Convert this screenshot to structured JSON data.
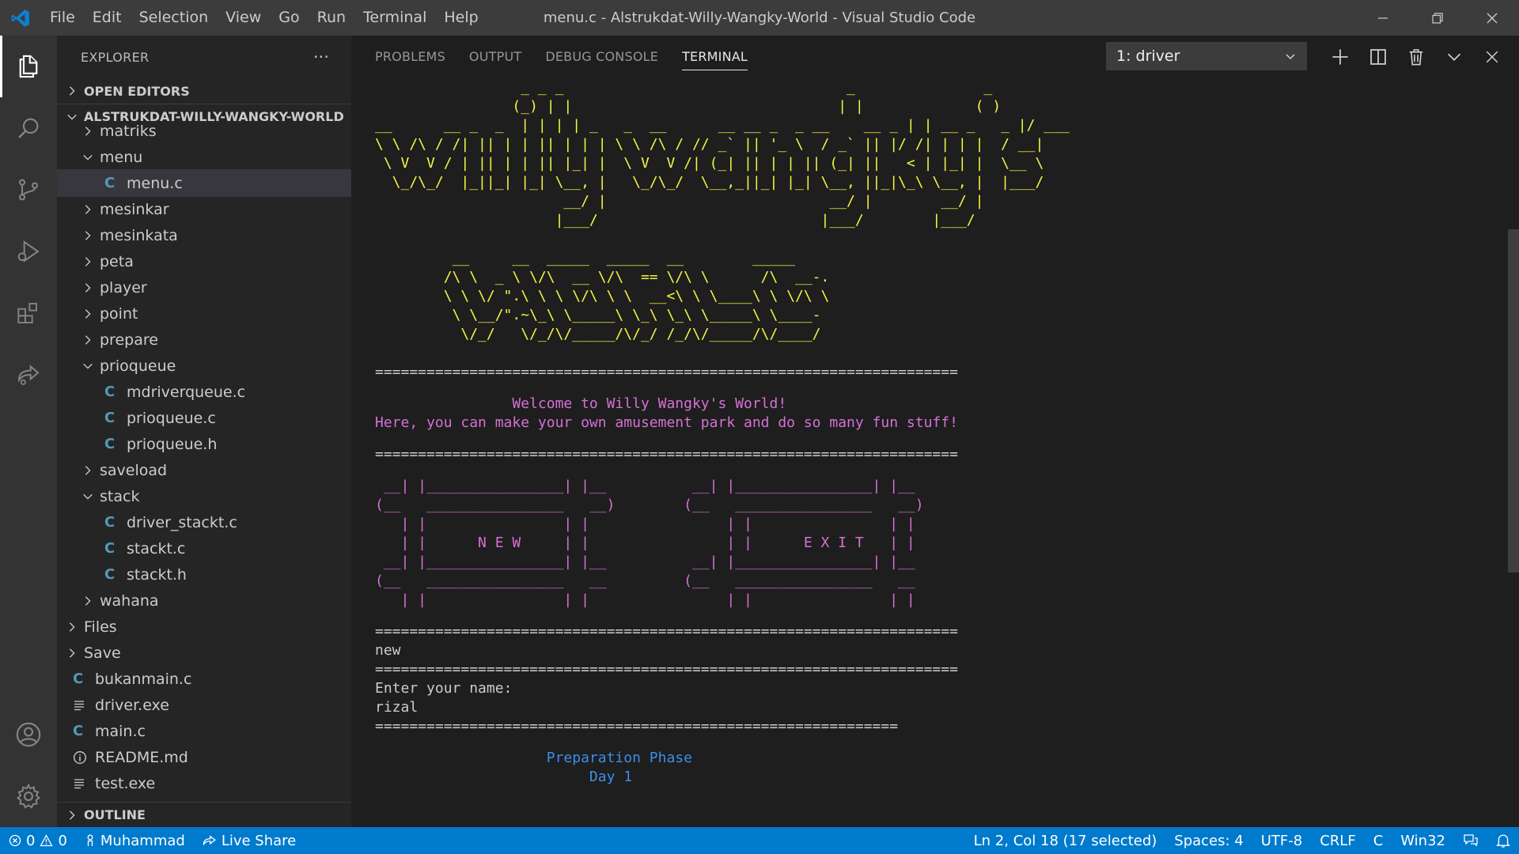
{
  "titlebar": {
    "menu": [
      "File",
      "Edit",
      "Selection",
      "View",
      "Go",
      "Run",
      "Terminal",
      "Help"
    ],
    "title": "menu.c - Alstrukdat-Willy-Wangky-World - Visual Studio Code"
  },
  "sidebar": {
    "header": "EXPLORER",
    "more": "···",
    "open_editors": "OPEN EDITORS",
    "project": "ALSTRUKDAT-WILLY-WANGKY-WORLD",
    "tree": [
      {
        "label": "matriks",
        "type": "folder",
        "state": "collapsed"
      },
      {
        "label": "menu",
        "type": "folder",
        "state": "expanded"
      },
      {
        "label": "menu.c",
        "type": "c",
        "selected": true
      },
      {
        "label": "mesinkar",
        "type": "folder",
        "state": "collapsed"
      },
      {
        "label": "mesinkata",
        "type": "folder",
        "state": "collapsed"
      },
      {
        "label": "peta",
        "type": "folder",
        "state": "collapsed"
      },
      {
        "label": "player",
        "type": "folder",
        "state": "collapsed"
      },
      {
        "label": "point",
        "type": "folder",
        "state": "collapsed"
      },
      {
        "label": "prepare",
        "type": "folder",
        "state": "collapsed"
      },
      {
        "label": "prioqueue",
        "type": "folder",
        "state": "expanded"
      },
      {
        "label": "mdriverqueue.c",
        "type": "c"
      },
      {
        "label": "prioqueue.c",
        "type": "c"
      },
      {
        "label": "prioqueue.h",
        "type": "c"
      },
      {
        "label": "saveload",
        "type": "folder",
        "state": "collapsed"
      },
      {
        "label": "stack",
        "type": "folder",
        "state": "expanded"
      },
      {
        "label": "driver_stackt.c",
        "type": "c"
      },
      {
        "label": "stackt.c",
        "type": "c"
      },
      {
        "label": "stackt.h",
        "type": "c"
      },
      {
        "label": "wahana",
        "type": "folder",
        "state": "collapsed"
      },
      {
        "label": "Files",
        "type": "folder",
        "state": "collapsed"
      },
      {
        "label": "Save",
        "type": "folder",
        "state": "collapsed"
      },
      {
        "label": "bukanmain.c",
        "type": "c"
      },
      {
        "label": "driver.exe",
        "type": "text"
      },
      {
        "label": "main.c",
        "type": "c"
      },
      {
        "label": "README.md",
        "type": "info"
      },
      {
        "label": "test.exe",
        "type": "text"
      }
    ],
    "outline": "OUTLINE"
  },
  "panel": {
    "tabs": [
      "PROBLEMS",
      "OUTPUT",
      "DEBUG CONSOLE",
      "TERMINAL"
    ],
    "active_tab": "TERMINAL",
    "terminal_select": "1: driver"
  },
  "terminal": {
    "logo1": "                 _ _ _                                 _               _\n                (_) | |                               | |             ( )\n__      __ _  _  | | | | _   _  __      __ __ _  _ __    __ _ | | __ _   _ |/ ___\n\\ \\ /\\ / /| || | | || | | | \\ \\ /\\ / // _` || '_ \\  / _` || |/ /| | | |  / __|\n \\ V  V / | || | | || |_| |  \\ V  V /| (_| || | | || (_| ||   < | |_| |  \\__ \\\n  \\_/\\_/  |_||_| |_| \\__, |   \\_/\\_/  \\__,_||_| |_| \\__, ||_|\\_\\ \\__, |  |___/\n                      __/ |                          __/ |        __/ |\n                     |___/                          |___/        |___/",
    "logo2": "         __     __  _____  _____  __        _____\n        /\\ \\  _ \\ \\/\\  __ \\/\\  == \\/\\ \\      /\\  __-.\n        \\ \\ \\/ \".\\ \\ \\ \\/\\ \\ \\  __<\\ \\ \\____\\ \\ \\/\\ \\\n         \\ \\__/\".~\\_\\ \\_____\\ \\_\\ \\_\\ \\_____\\ \\____-\n          \\/_/   \\/_/\\/_____/\\/_/ /_/\\/_____/\\/____/",
    "separator": "====================================================================",
    "welcome1": "                Welcome to Willy Wangky's World!",
    "welcome2": "Here, you can make your own amusement park and do so many fun stuff!",
    "menu_art": " __| |________________| |__          __| |________________| |__\n(__   ________________   __)        (__   ________________   __)\n   | |                | |                | |                | |\n   | |      N E W     | |                | |      E X I T   | |\n __| |________________| |__          __| |________________| |__\n(__   ________________   __         (__   ________________   __\n   | |                | |                | |                | |",
    "input_new": "new",
    "prompt": "Enter your name:",
    "name": "rizal",
    "separator_short": "=============================================================",
    "phase": "                    Preparation Phase",
    "day": "                         Day 1"
  },
  "statusbar": {
    "errors": "0",
    "warnings": "0",
    "branch": "Muhammad",
    "live_share": "Live Share",
    "cursor": "Ln 2, Col 18 (17 selected)",
    "spaces": "Spaces: 4",
    "encoding": "UTF-8",
    "eol": "CRLF",
    "language": "C",
    "platform": "Win32"
  },
  "colors": {
    "accent": "#007acc",
    "terminal_yellow": "#f5f543",
    "terminal_magenta": "#d670d6",
    "terminal_blue": "#3b8eea",
    "c_file_icon": "#519aba"
  }
}
